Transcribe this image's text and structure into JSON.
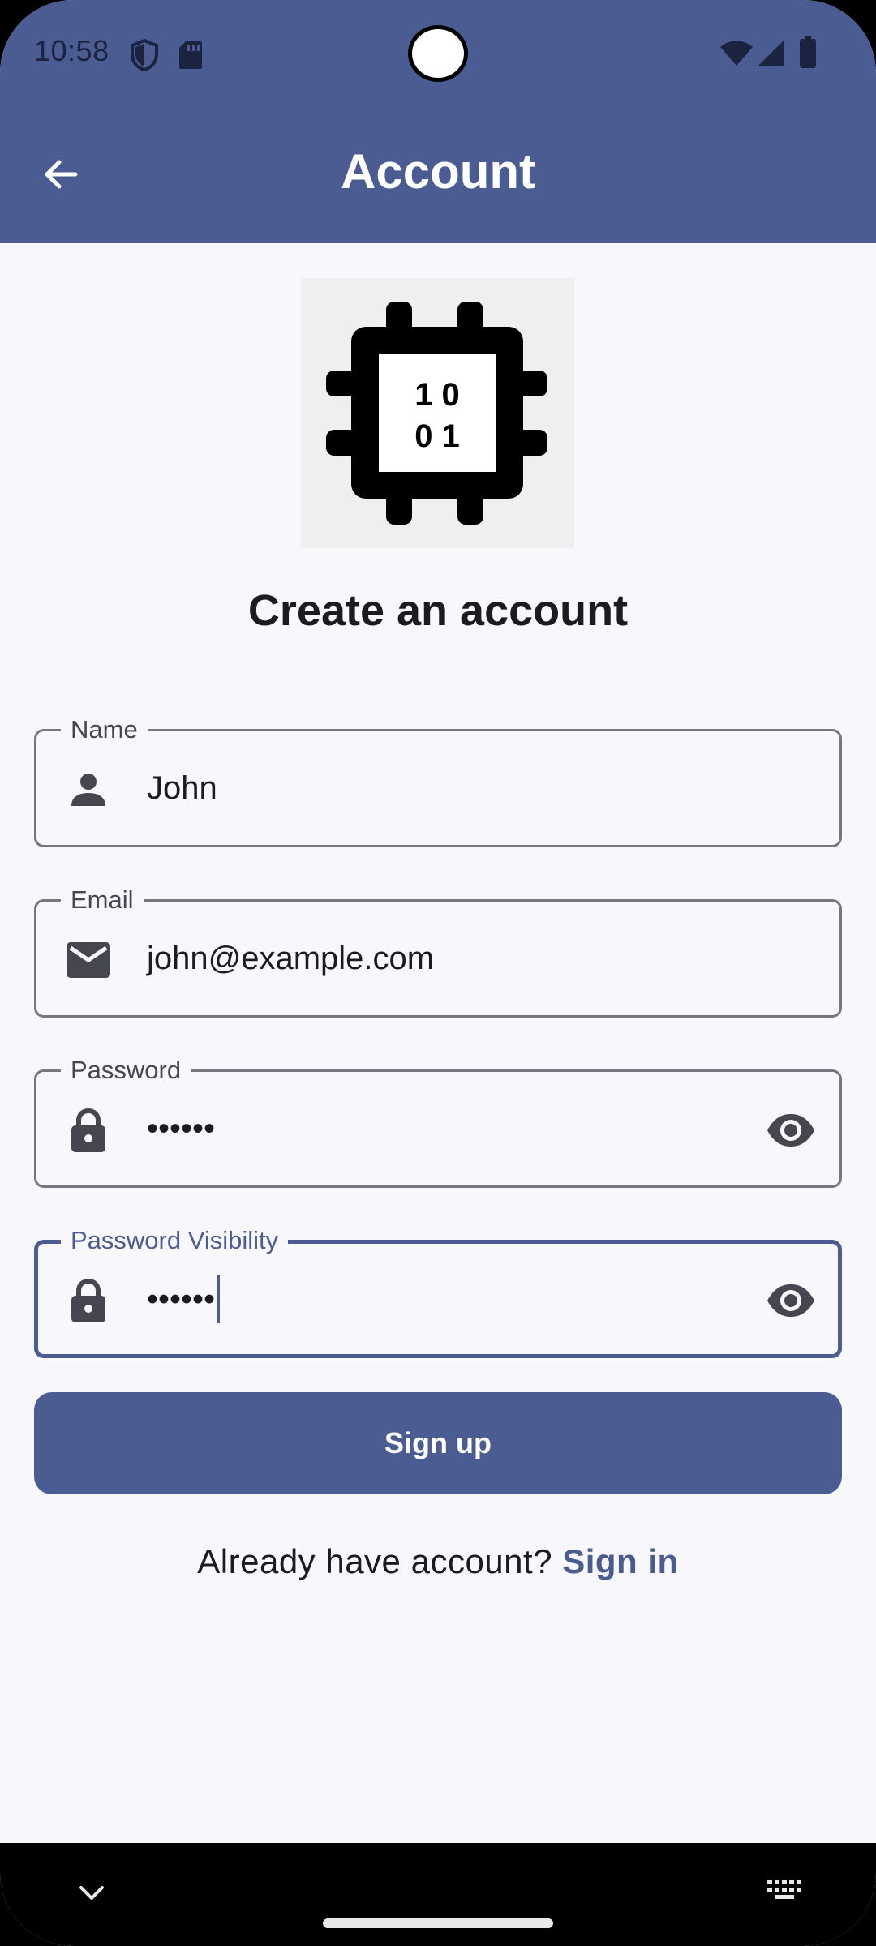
{
  "status_bar": {
    "time": "10:58",
    "icons": [
      "shield-icon",
      "sd-card-icon",
      "wifi-icon",
      "signal-icon",
      "battery-icon"
    ]
  },
  "app_bar": {
    "title": "Account",
    "back_icon": "arrow-back-icon"
  },
  "logo": {
    "icon": "cpu-chip-icon",
    "text": [
      "1 0",
      "0 1"
    ]
  },
  "heading": "Create an account",
  "form": {
    "name": {
      "label": "Name",
      "value": "John",
      "icon": "person-icon"
    },
    "email": {
      "label": "Email",
      "value": "john@example.com",
      "icon": "mail-icon"
    },
    "password": {
      "label": "Password",
      "value": "••••••",
      "icon": "lock-icon",
      "trailing_icon": "eye-icon"
    },
    "password_visibility": {
      "label": "Password Visibility",
      "value": "••••••",
      "icon": "lock-icon",
      "trailing_icon": "eye-icon",
      "focused": true
    }
  },
  "signup_button": "Sign up",
  "signin": {
    "prompt": "Already have account?",
    "link": "Sign in"
  },
  "colors": {
    "primary": "#4a5c92",
    "background": "#f7f7fc",
    "outline": "#76767e",
    "text": "#1b1b21"
  }
}
